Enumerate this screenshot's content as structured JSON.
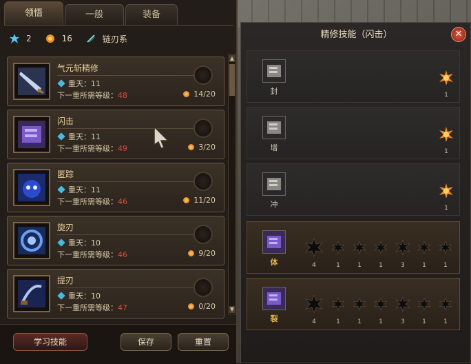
{
  "tabs": [
    {
      "label": "领悟",
      "active": true
    },
    {
      "label": "一般",
      "active": false
    },
    {
      "label": "装备",
      "active": false
    }
  ],
  "stats": {
    "star_points": "2",
    "gold_points": "16",
    "school": "链刃系"
  },
  "skills": [
    {
      "name": "气元斩精修",
      "tier_label": "重天：11",
      "req_label": "下一重所需等级：",
      "req_level": "48",
      "cost": "14/20",
      "icon": "blade-icon"
    },
    {
      "name": "闪击",
      "tier_label": "重天：11",
      "req_label": "下一重所需等级：",
      "req_level": "49",
      "cost": "3/20",
      "icon": "flash-strike-icon"
    },
    {
      "name": "匿踪",
      "tier_label": "重天：11",
      "req_label": "下一重所需等级：",
      "req_level": "46",
      "cost": "11/20",
      "icon": "stealth-icon"
    },
    {
      "name": "旋刃",
      "tier_label": "重天：10",
      "req_label": "下一重所需等级：",
      "req_level": "46",
      "cost": "9/20",
      "icon": "spin-blade-icon"
    },
    {
      "name": "提刃",
      "tier_label": "重天：10",
      "req_label": "下一重所需等级：",
      "req_level": "47",
      "cost": "0/20",
      "icon": "lift-blade-icon"
    }
  ],
  "buttons": {
    "learn": "学习技能",
    "save": "保存",
    "reset": "重置"
  },
  "refine": {
    "title": "精修技能（闪击）",
    "close": "✕",
    "rows": [
      {
        "label": "封",
        "style": "grey",
        "value": "1"
      },
      {
        "label": "增",
        "style": "grey",
        "value": "1"
      },
      {
        "label": "冲",
        "style": "grey",
        "value": "1"
      },
      {
        "label": "体",
        "style": "brown",
        "nodes": [
          "4",
          "1",
          "1",
          "1",
          "3",
          "1",
          "1"
        ]
      },
      {
        "label": "裂",
        "style": "brown",
        "nodes": [
          "4",
          "1",
          "1",
          "1",
          "3",
          "1",
          "1"
        ]
      }
    ]
  },
  "colors": {
    "accent_gold": "#e8d29c",
    "level_red": "#e04a3a",
    "gem_blue": "#4ab9e0"
  }
}
